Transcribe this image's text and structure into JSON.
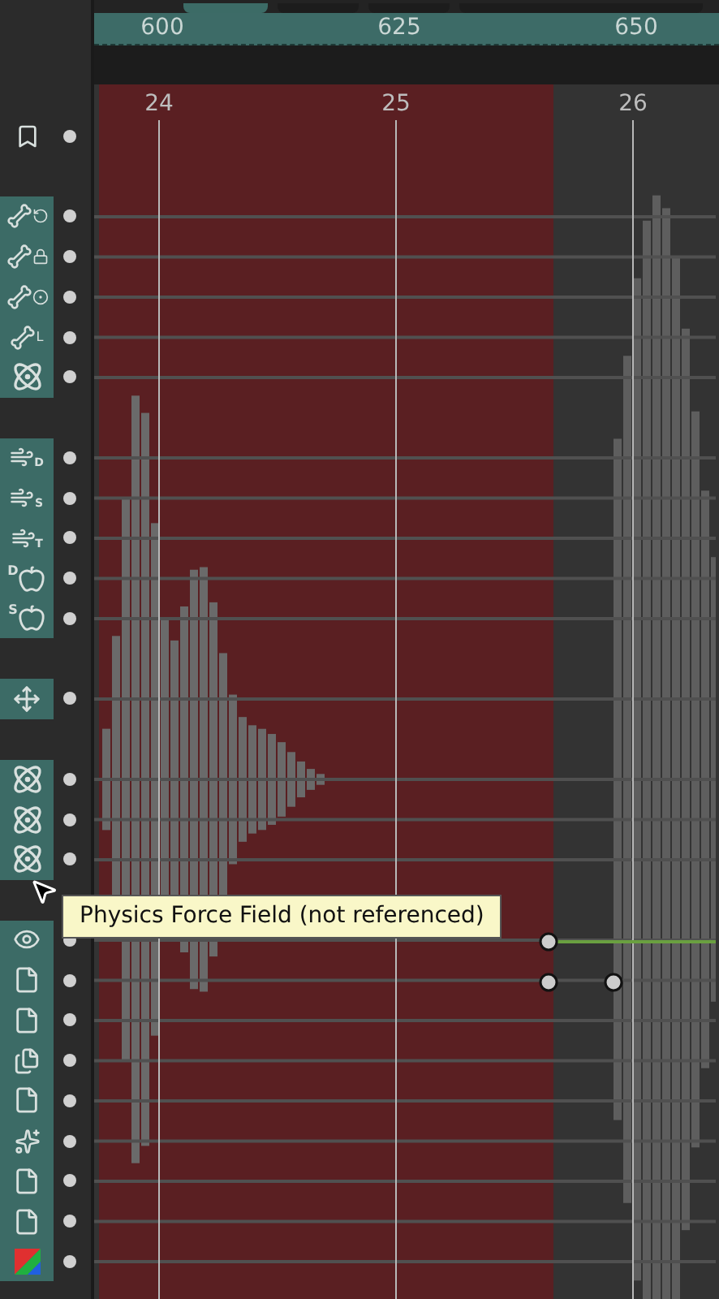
{
  "ruler": {
    "labels": [
      "600",
      "625",
      "650"
    ]
  },
  "frames": {
    "labels": [
      "24",
      "25",
      "26"
    ]
  },
  "groups": [
    {
      "highlighted": false,
      "channels": [
        {
          "kind": "marker"
        }
      ]
    },
    {
      "highlighted": true,
      "channels": [
        {
          "kind": "bone-rotate"
        },
        {
          "kind": "bone-lock"
        },
        {
          "kind": "bone-target"
        },
        {
          "kind": "bone-limit",
          "badge": "L"
        },
        {
          "kind": "atom"
        }
      ]
    },
    {
      "highlighted": true,
      "channels": [
        {
          "kind": "wind",
          "badge": "D"
        },
        {
          "kind": "wind",
          "badge": "S"
        },
        {
          "kind": "wind",
          "badge": "T"
        },
        {
          "kind": "apple",
          "prefix": "D"
        },
        {
          "kind": "apple",
          "prefix": "S"
        }
      ]
    },
    {
      "highlighted": true,
      "channels": [
        {
          "kind": "file-move"
        }
      ]
    },
    {
      "highlighted": true,
      "channels": [
        {
          "kind": "atom"
        },
        {
          "kind": "atom"
        },
        {
          "kind": "atom"
        }
      ]
    },
    {
      "highlighted": true,
      "channels": [
        {
          "kind": "file-eye"
        },
        {
          "kind": "file-dotted"
        },
        {
          "kind": "file-blur"
        },
        {
          "kind": "file-stack"
        },
        {
          "kind": "file-gradient"
        },
        {
          "kind": "file-sparkle"
        },
        {
          "kind": "file-fold"
        },
        {
          "kind": "file-inner"
        },
        {
          "kind": "color"
        }
      ]
    }
  ],
  "tooltip": {
    "text": "Physics Force Field (not referenced)"
  }
}
